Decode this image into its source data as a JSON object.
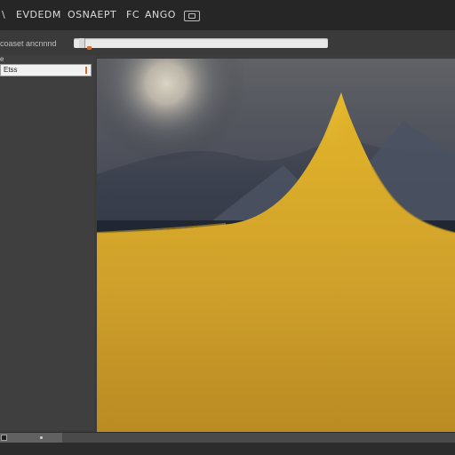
{
  "menubar": {
    "back_label": "\\",
    "items": [
      {
        "label": "EVDEDM"
      },
      {
        "label": "OSNAEPT"
      },
      {
        "label": "FC"
      },
      {
        "label": "ANGO"
      }
    ],
    "icon": "window-icon"
  },
  "toolbar": {
    "label": "coaset ancnnnd",
    "slider_value": 0.02
  },
  "sidebar": {
    "top_label": "e",
    "field_value": "Etss"
  },
  "canvas": {
    "image_name": "yellow-peak-mountain-landscape",
    "colors": {
      "sky": "#3a3f4d",
      "sun": "#fff1cf",
      "mountain": "#4a5262",
      "land": "#1f2530",
      "yellow": "#d1a32b"
    }
  },
  "statusbar": {
    "left_icon": "status-square-icon"
  }
}
